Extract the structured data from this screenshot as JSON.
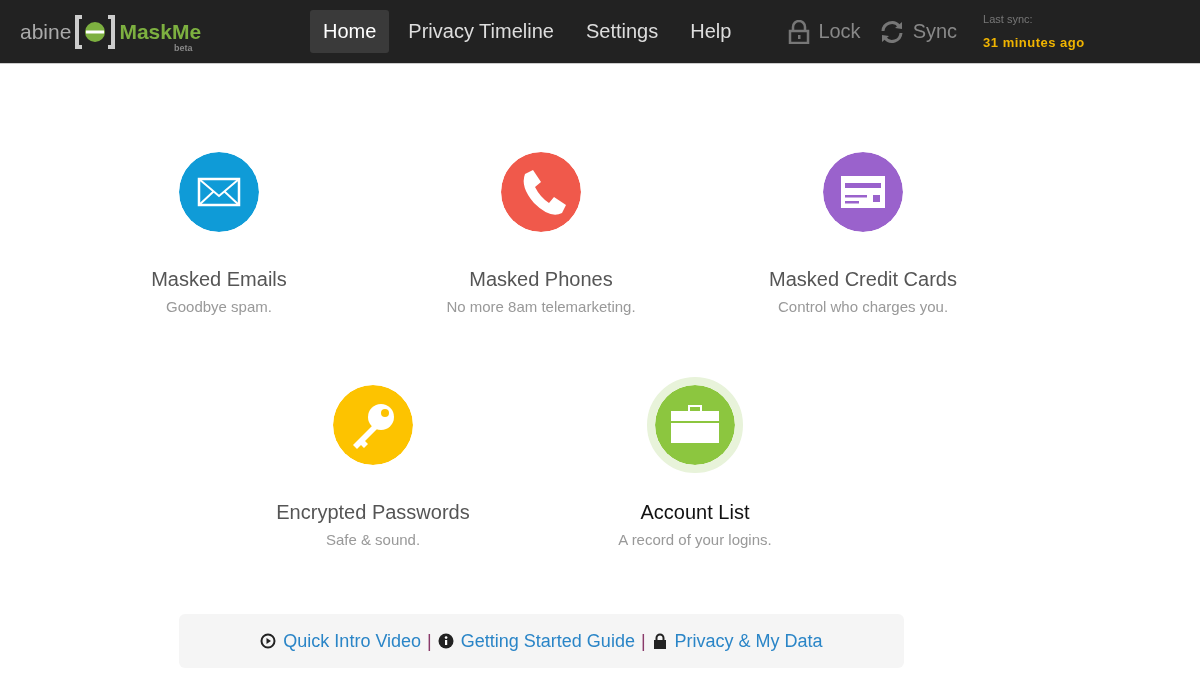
{
  "header": {
    "logo": {
      "brand": "abine",
      "product": "MaskMe",
      "tag": "beta"
    },
    "nav": [
      {
        "label": "Home",
        "selected": true
      },
      {
        "label": "Privacy Timeline",
        "selected": false
      },
      {
        "label": "Settings",
        "selected": false
      },
      {
        "label": "Help",
        "selected": false
      }
    ],
    "actions": [
      {
        "label": "Lock"
      },
      {
        "label": "Sync"
      }
    ],
    "last_sync": {
      "label": "Last sync:",
      "value": "31 minutes ago"
    }
  },
  "features": [
    [
      {
        "title": "Masked Emails",
        "subtitle": "Goodbye spam.",
        "color": "#0f9bd7",
        "selected": false
      },
      {
        "title": "Masked Phones",
        "subtitle": "No more 8am telemarketing.",
        "color": "#f0594b",
        "selected": false
      },
      {
        "title": "Masked Credit Cards",
        "subtitle": "Control who charges you.",
        "color": "#9a62cc",
        "selected": false
      }
    ],
    [
      {
        "title": "Encrypted Passwords",
        "subtitle": "Safe & sound.",
        "color": "#fdc300",
        "selected": false
      },
      {
        "title": "Account List",
        "subtitle": "A record of your logins.",
        "color": "#8cc63f",
        "selected": true
      }
    ]
  ],
  "footer": [
    {
      "kind": "link",
      "label": "Quick Intro Video"
    },
    {
      "kind": "separator",
      "label": "|"
    },
    {
      "kind": "link",
      "label": "Getting Started Guide"
    },
    {
      "kind": "separator",
      "label": "|"
    },
    {
      "kind": "link",
      "label": "Privacy & My Data"
    }
  ]
}
